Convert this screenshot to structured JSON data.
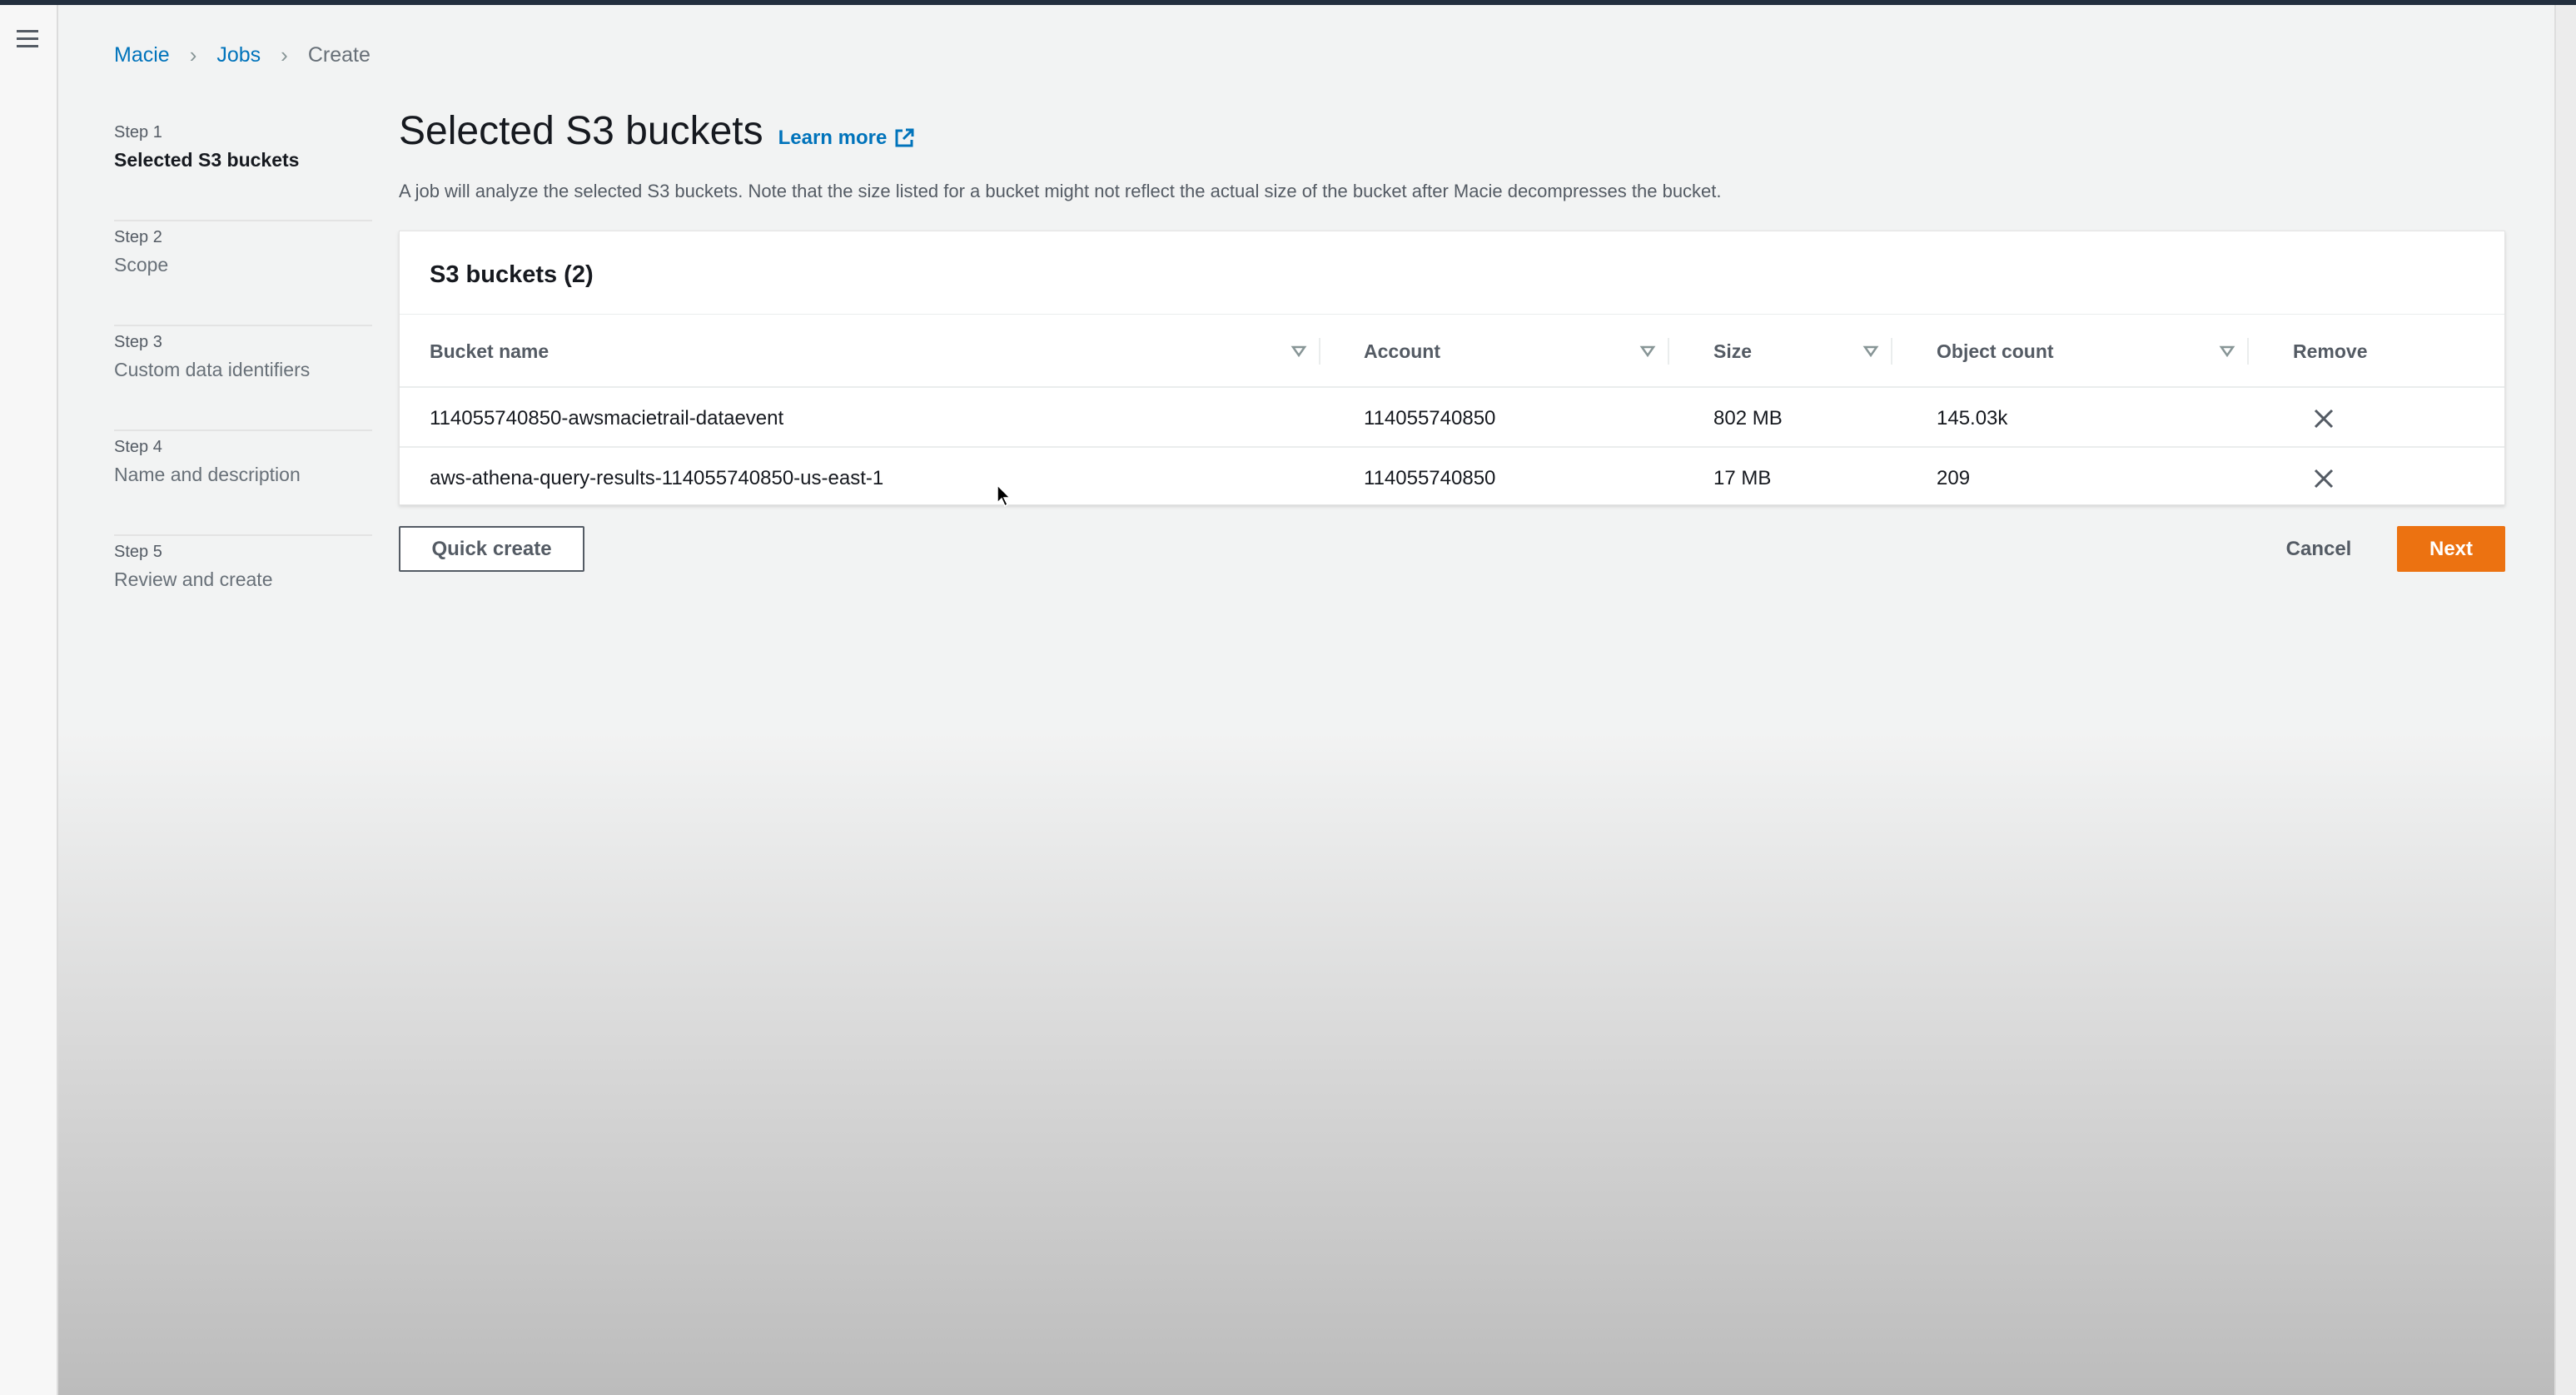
{
  "breadcrumb": {
    "items": [
      "Macie",
      "Jobs",
      "Create"
    ]
  },
  "steps": [
    {
      "num": "Step 1",
      "label": "Selected S3 buckets",
      "active": true
    },
    {
      "num": "Step 2",
      "label": "Scope"
    },
    {
      "num": "Step 3",
      "label": "Custom data identifiers"
    },
    {
      "num": "Step 4",
      "label": "Name and description"
    },
    {
      "num": "Step 5",
      "label": "Review and create"
    }
  ],
  "page": {
    "title": "Selected S3 buckets",
    "learn_more": "Learn more",
    "description": "A job will analyze the selected S3 buckets. Note that the size listed for a bucket might not reflect the actual size of the bucket after Macie decompresses the bucket."
  },
  "table": {
    "title": "S3 buckets (2)",
    "columns": [
      "Bucket name",
      "Account",
      "Size",
      "Object count",
      "Remove"
    ],
    "rows": [
      {
        "bucket": "114055740850-awsmacietrail-dataevent",
        "account": "114055740850",
        "size": "802 MB",
        "objects": "145.03k"
      },
      {
        "bucket": "aws-athena-query-results-114055740850-us-east-1",
        "account": "114055740850",
        "size": "17 MB",
        "objects": "209"
      }
    ]
  },
  "actions": {
    "quick_create": "Quick create",
    "cancel": "Cancel",
    "next": "Next"
  },
  "colors": {
    "accent": "#ec7211",
    "link": "#0073bb",
    "header": "#232f3e"
  },
  "icons": [
    "menu-icon",
    "chevron-right-icon",
    "external-link-icon",
    "sort-caret-icon",
    "close-icon",
    "mouse-cursor-icon"
  ]
}
